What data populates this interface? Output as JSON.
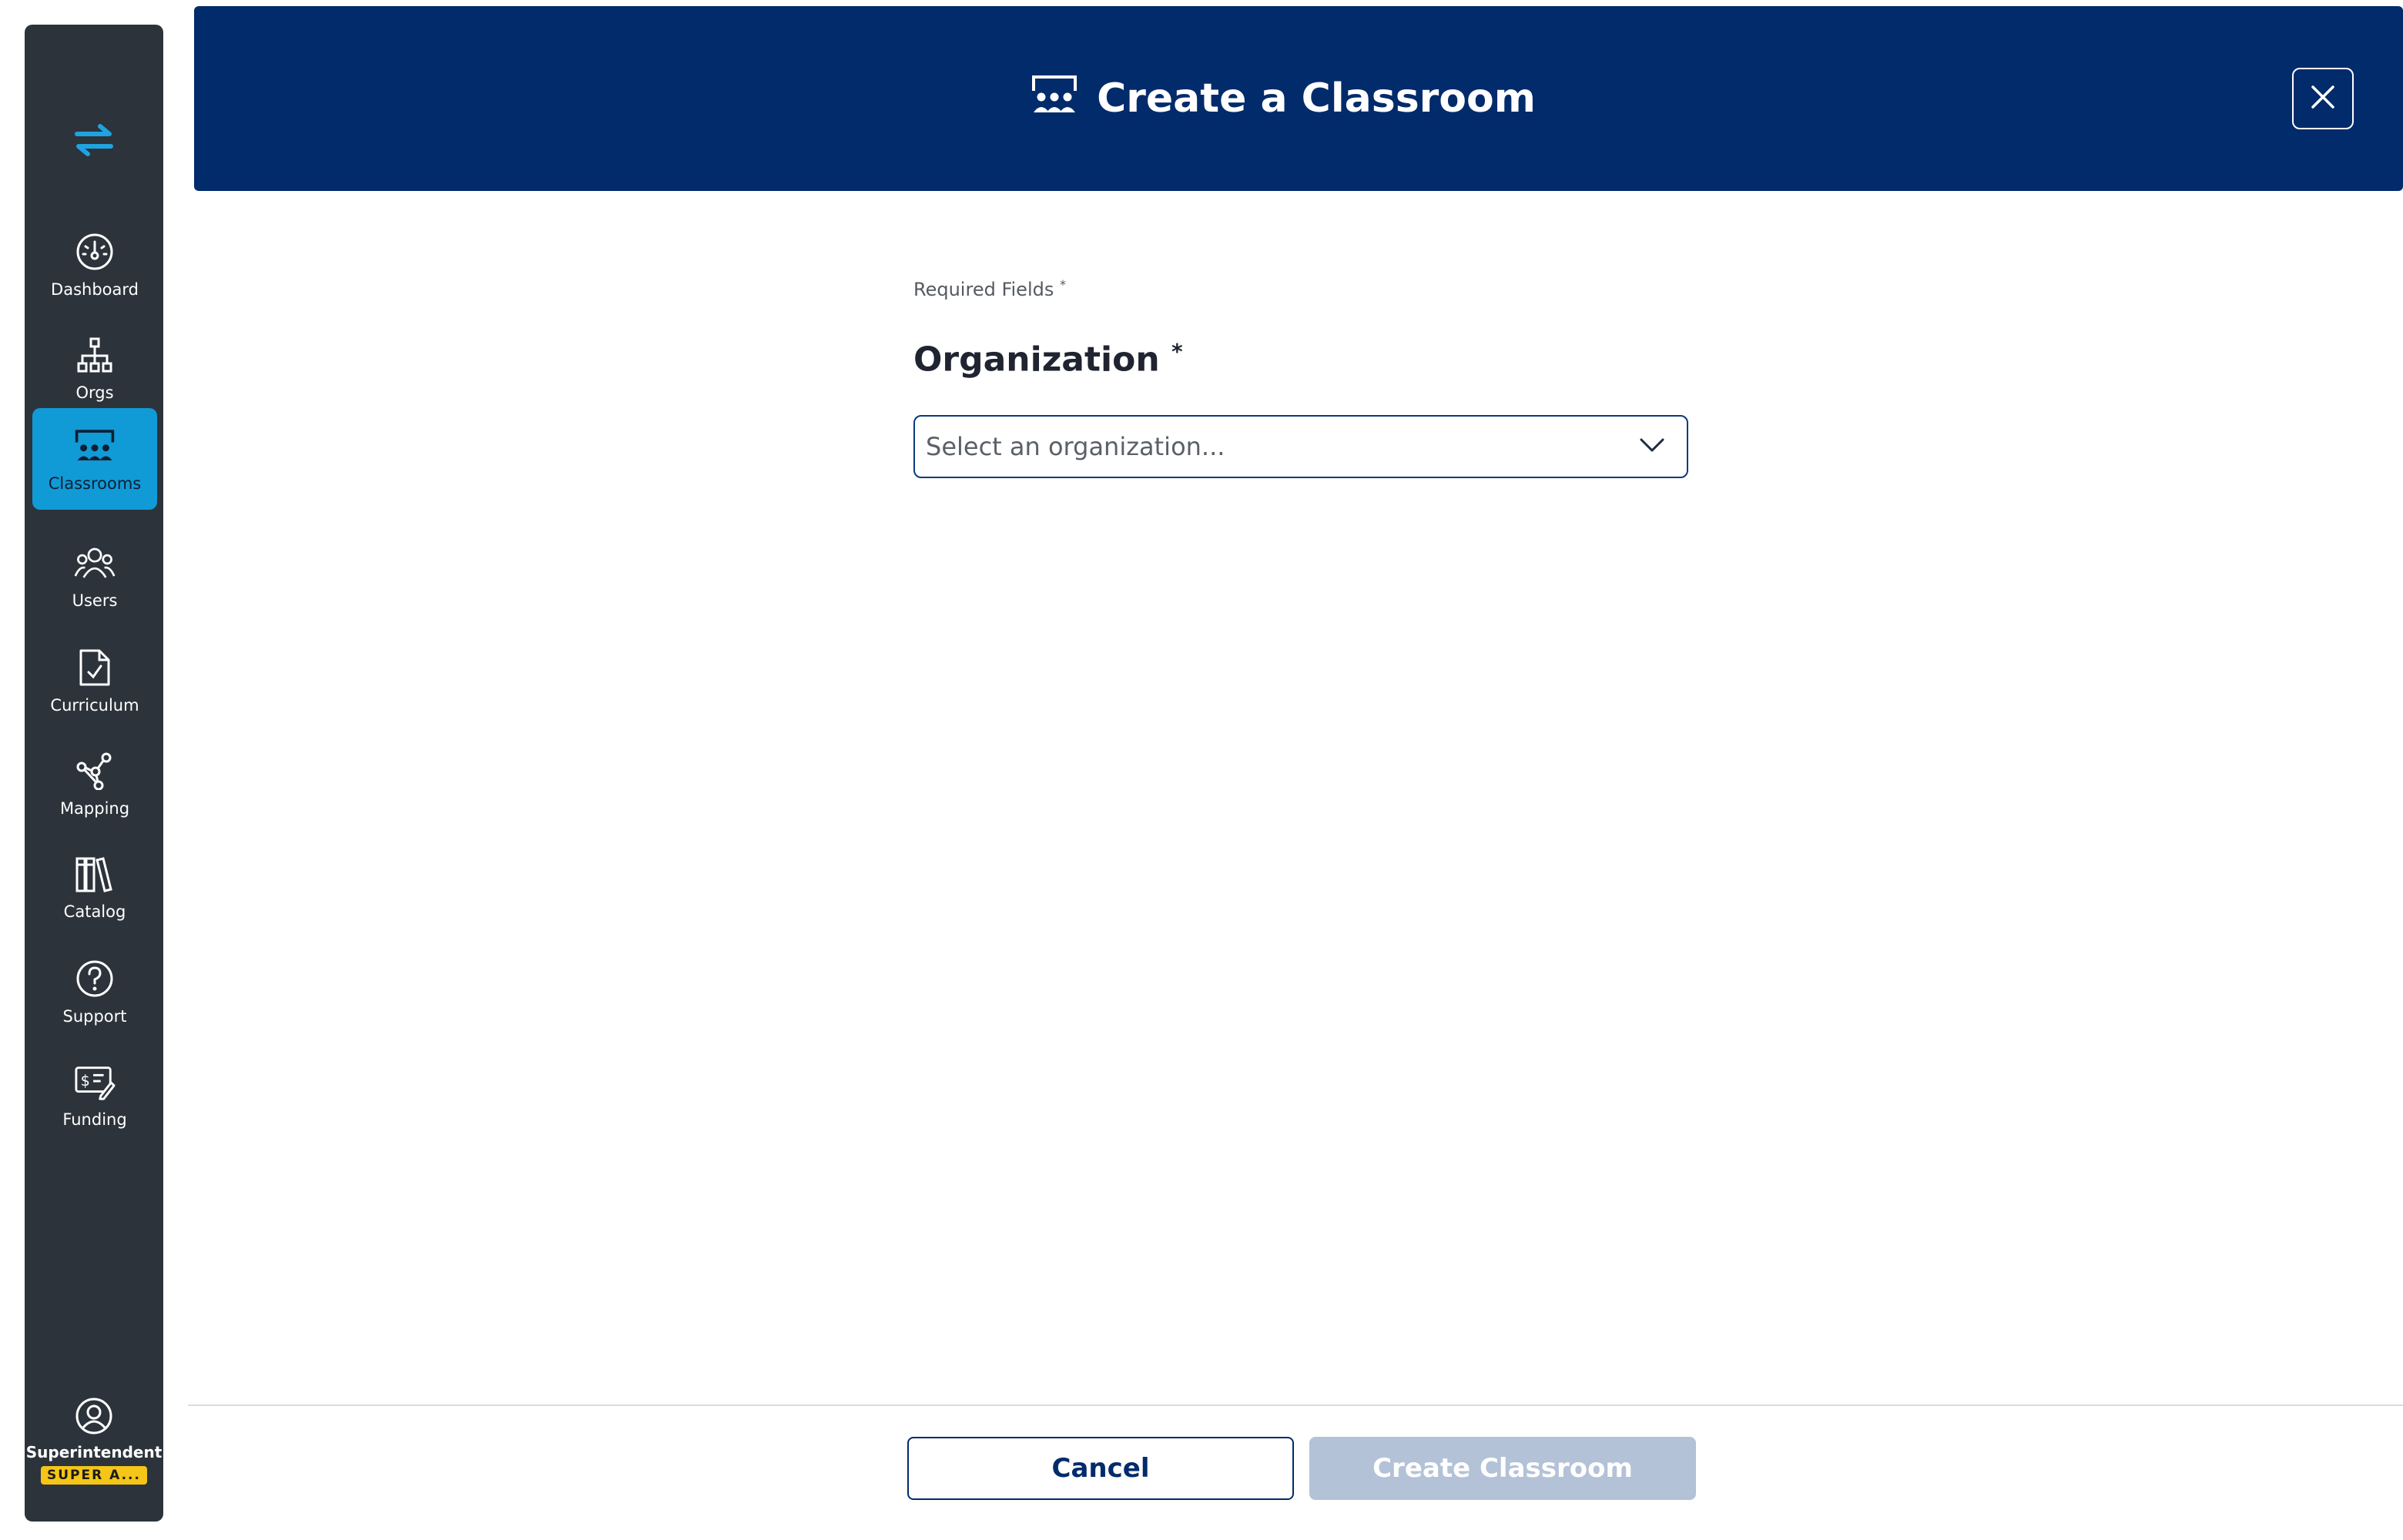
{
  "sidebar": {
    "logo_icon": "swap-arrows-icon",
    "items": [
      {
        "label": "Dashboard",
        "icon": "gauge-icon"
      },
      {
        "label": "Orgs",
        "icon": "org-chart-icon"
      },
      {
        "label": "Classrooms",
        "icon": "classroom-icon",
        "active": true
      },
      {
        "label": "Users",
        "icon": "users-icon"
      },
      {
        "label": "Curriculum",
        "icon": "document-check-icon"
      },
      {
        "label": "Mapping",
        "icon": "network-icon"
      },
      {
        "label": "Catalog",
        "icon": "books-icon"
      },
      {
        "label": "Support",
        "icon": "question-icon"
      },
      {
        "label": "Funding",
        "icon": "funding-icon"
      }
    ],
    "user": {
      "name": "Superintendent",
      "badge": "SUPER A...",
      "icon": "user-circle-icon"
    }
  },
  "header": {
    "title": "Create a Classroom",
    "title_icon": "classroom-icon",
    "close_icon": "close-icon"
  },
  "form": {
    "required_note": "Required Fields",
    "required_marker": "*",
    "organization_label": "Organization",
    "organization_marker": "*",
    "organization_select": {
      "value": "Select an organization...",
      "icon": "chevron-down-icon"
    }
  },
  "footer": {
    "cancel_label": "Cancel",
    "create_label": "Create Classroom"
  },
  "colors": {
    "sidebar_bg": "#2c333b",
    "active_item": "#109ad6",
    "header_bg": "#012b6b",
    "badge": "#f5c518",
    "disabled_button": "#b3c2d6"
  }
}
